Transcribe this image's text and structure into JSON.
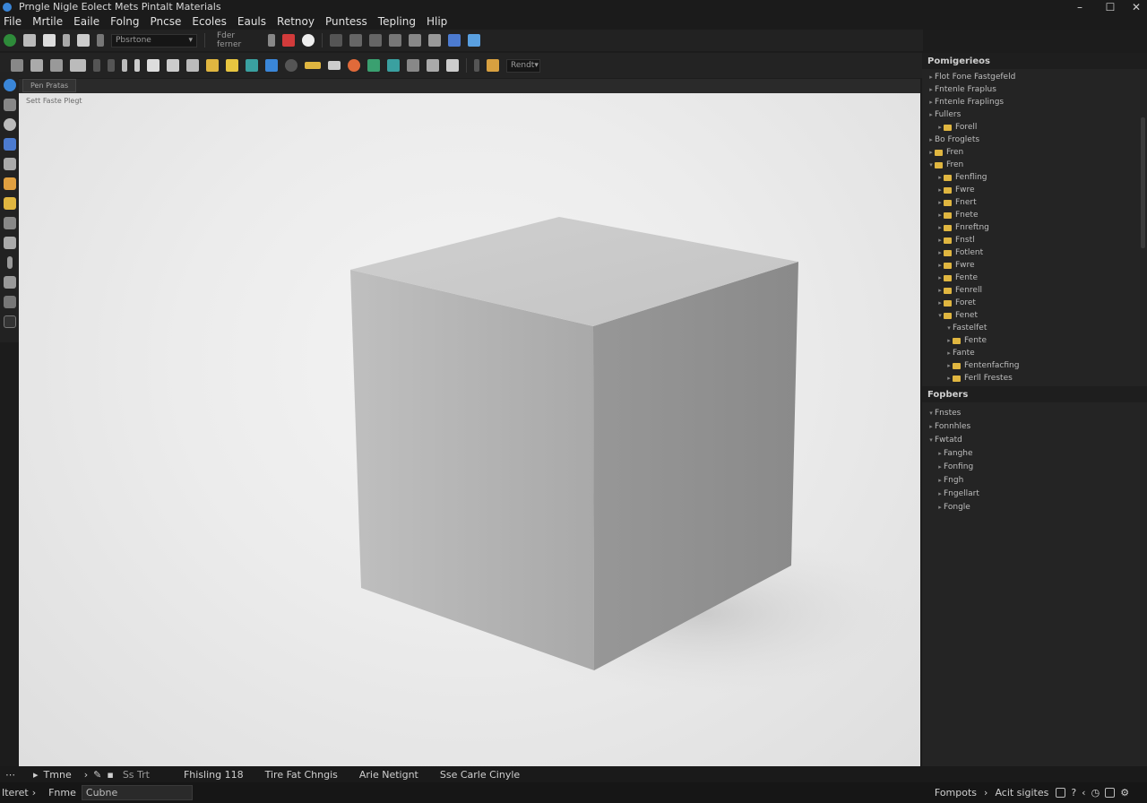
{
  "window": {
    "title": "Prngle Nigle Eolect Mets Pintalt Materials",
    "controls": [
      "–",
      "☐",
      "✕"
    ]
  },
  "menu": [
    "File",
    "Mrtile",
    "Eaile",
    "Folng",
    "Pncse",
    "Ecoles",
    "Eauls",
    "Retnoy",
    "Puntess",
    "Tepling",
    "Hlip"
  ],
  "toolbar1": {
    "dropdown_1": "Pbsrtone",
    "dropdown_2": "Fder ferner"
  },
  "toolbar2": {
    "dropdown_1": "Rendt"
  },
  "viewport": {
    "tab": "Pen Pratas",
    "label": "Sett Faste Plegt"
  },
  "panels": {
    "top": {
      "title": "Pomigerieos",
      "items": [
        {
          "label": "Flot Fone Fastgefeld",
          "depth": 0,
          "folder": false,
          "arrow": "▸"
        },
        {
          "label": "Fntenle Fraplus",
          "depth": 0,
          "folder": false,
          "arrow": "▸"
        },
        {
          "label": "Fntenle Fraplings",
          "depth": 0,
          "folder": false,
          "arrow": "▸"
        },
        {
          "label": "Fullers",
          "depth": 0,
          "folder": false,
          "arrow": "▸"
        },
        {
          "label": "Forell",
          "depth": 1,
          "folder": true,
          "arrow": "▸"
        },
        {
          "label": "Bo Froglets",
          "depth": 0,
          "folder": false,
          "arrow": "▸"
        },
        {
          "label": "Fren",
          "depth": 0,
          "folder": true,
          "arrow": "▸"
        },
        {
          "label": "Fren",
          "depth": 0,
          "folder": true,
          "arrow": "▾"
        },
        {
          "label": "Fenfling",
          "depth": 1,
          "folder": true,
          "arrow": "▸"
        },
        {
          "label": "Fwre",
          "depth": 1,
          "folder": true,
          "arrow": "▸"
        },
        {
          "label": "Fnert",
          "depth": 1,
          "folder": true,
          "arrow": "▸"
        },
        {
          "label": "Fnete",
          "depth": 1,
          "folder": true,
          "arrow": "▸"
        },
        {
          "label": "Fnreftng",
          "depth": 1,
          "folder": true,
          "arrow": "▸"
        },
        {
          "label": "Fnstl",
          "depth": 1,
          "folder": true,
          "arrow": "▸"
        },
        {
          "label": "Fotlent",
          "depth": 1,
          "folder": true,
          "arrow": "▸"
        },
        {
          "label": "Fwre",
          "depth": 1,
          "folder": true,
          "arrow": "▸"
        },
        {
          "label": "Fente",
          "depth": 1,
          "folder": true,
          "arrow": "▸"
        },
        {
          "label": "Fenrell",
          "depth": 1,
          "folder": true,
          "arrow": "▸"
        },
        {
          "label": "Foret",
          "depth": 1,
          "folder": true,
          "arrow": "▸"
        },
        {
          "label": "Fenet",
          "depth": 1,
          "folder": true,
          "arrow": "▾"
        },
        {
          "label": "Fastelfet",
          "depth": 2,
          "folder": false,
          "arrow": "▾"
        },
        {
          "label": "Fente",
          "depth": 2,
          "folder": true,
          "arrow": "▸"
        },
        {
          "label": "Fante",
          "depth": 2,
          "folder": false,
          "arrow": "▸"
        },
        {
          "label": "Fentenfacfing",
          "depth": 2,
          "folder": true,
          "arrow": "▸"
        },
        {
          "label": "Ferll Frestes",
          "depth": 2,
          "folder": true,
          "arrow": "▸"
        }
      ]
    },
    "bottom": {
      "title": "Fopbers",
      "items": [
        {
          "label": "Fnstes",
          "depth": 0,
          "arrow": "▾"
        },
        {
          "label": "Fonnhles",
          "depth": 0,
          "arrow": "▸"
        },
        {
          "label": "Fwtatd",
          "depth": 0,
          "arrow": "▾"
        },
        {
          "label": "Fanghe",
          "depth": 1,
          "arrow": "▸"
        },
        {
          "label": "Fonfing",
          "depth": 1,
          "arrow": "▸"
        },
        {
          "label": "Fngh",
          "depth": 1,
          "arrow": "▸"
        },
        {
          "label": "Fngellart",
          "depth": 1,
          "arrow": "▸"
        },
        {
          "label": "Fongle",
          "depth": 1,
          "arrow": "▸"
        }
      ]
    }
  },
  "status": {
    "mode": "Tmne",
    "coords": "Ss Trt",
    "item1": "Fhisling 118",
    "item2": "Tire Fat Chngis",
    "item3": "Arie Netignt",
    "item4": "Sse Carle Cinyle"
  },
  "bottom": {
    "left_label": "Iteret",
    "field_label": "Fnme",
    "field_value": "Cubne",
    "right_label1": "Fompots",
    "right_label2": "Acit sigites"
  },
  "colors": {
    "accent_blue": "#3a86d8",
    "folder_yellow": "#e0b640",
    "viewport_bg": "#ececec",
    "purple_edge": "#8d5bd8"
  }
}
